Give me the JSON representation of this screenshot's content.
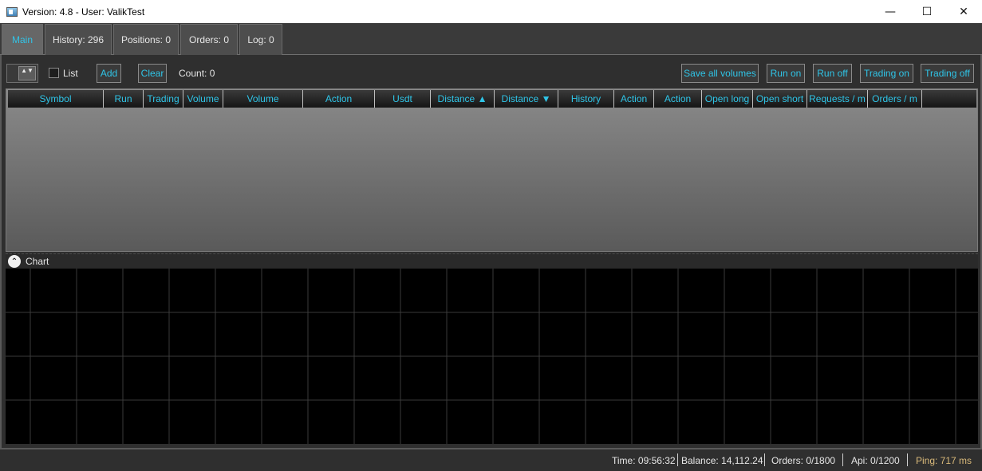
{
  "window": {
    "title": "Version: 4.8 - User: ValikTest",
    "minimize": "—",
    "maximize": "☐",
    "close": "✕"
  },
  "tabs": [
    {
      "label": "Main",
      "active": true
    },
    {
      "label": "History: 296"
    },
    {
      "label": "Positions: 0"
    },
    {
      "label": "Orders: 0"
    },
    {
      "label": "Log: 0"
    }
  ],
  "toolbar": {
    "spinner_glyph": "▲▼",
    "list_label": "List",
    "add_label": "Add",
    "clear_label": "Clear",
    "count_text": "Count: 0",
    "save_all_volumes": "Save all volumes",
    "run_on": "Run on",
    "run_off": "Run off",
    "trading_on": "Trading on",
    "trading_off": "Trading off"
  },
  "grid": {
    "columns": [
      "Symbol",
      "Run",
      "Trading",
      "Volume",
      "Volume",
      "Action",
      "Usdt",
      "Distance ▲",
      "Distance ▼",
      "History",
      "Action",
      "Action",
      "Open long",
      "Open short",
      "Requests / m",
      "Orders / m"
    ]
  },
  "chart": {
    "title": "Chart",
    "toggle_glyph": "⌃",
    "background": "#000000",
    "grid_color": "#3a3a3a"
  },
  "status": {
    "time": "Time: 09:56:32",
    "balance": "Balance: 14,112.24",
    "orders": "Orders: 0/1800",
    "api": "Api: 0/1200",
    "ping": "Ping: 717 ms"
  },
  "colors": {
    "accent": "#2fc5e8",
    "ping": "#d9b97a"
  }
}
